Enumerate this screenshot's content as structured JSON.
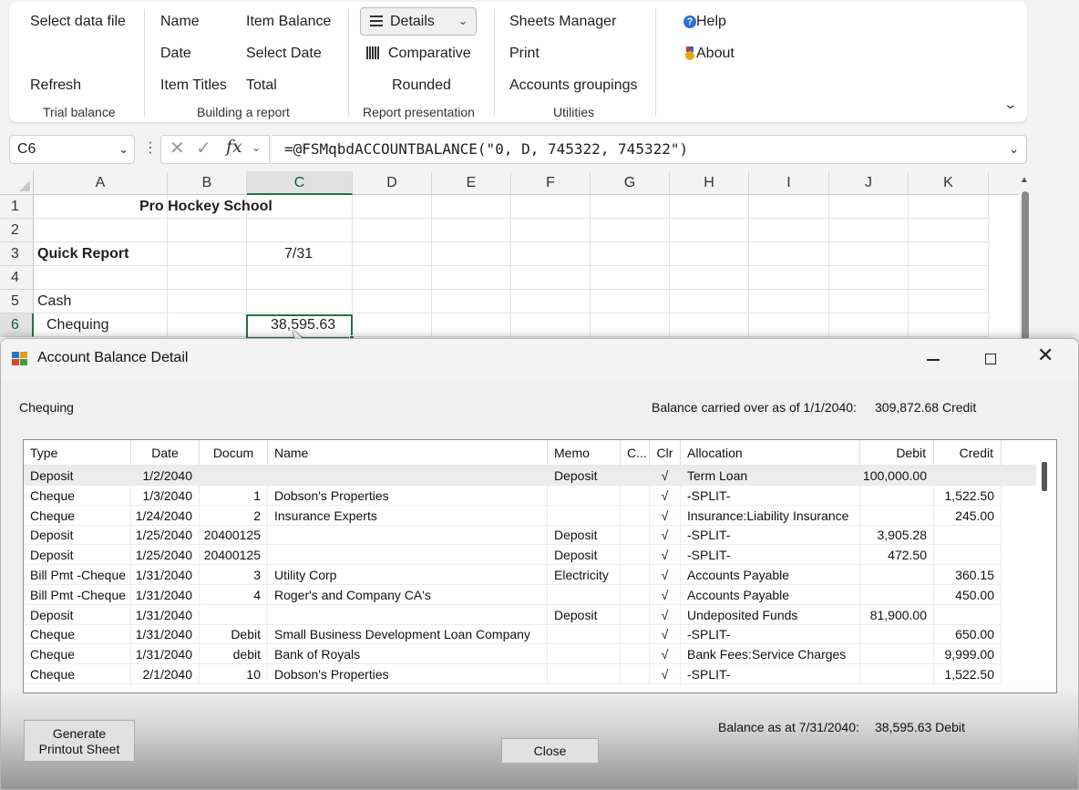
{
  "ribbon": {
    "groups": [
      {
        "label": "Trial balance",
        "buttons": [
          "Select data file",
          "Refresh"
        ]
      },
      {
        "label": "Building a report",
        "buttons": [
          "Name",
          "Item Balance",
          "Date",
          "Select Date",
          "Item Titles",
          "Total"
        ]
      },
      {
        "label": "Report presentation",
        "buttons": [
          "Details",
          "Comparative",
          "Rounded"
        ]
      },
      {
        "label": "Utilities",
        "buttons": [
          "Sheets Manager",
          "Print",
          "Accounts groupings"
        ]
      },
      {
        "label": "",
        "buttons": [
          "Help",
          "About"
        ]
      }
    ]
  },
  "formula_bar": {
    "name_box": "C6",
    "formula": "=@FSMqbdACCOUNTBALANCE(\"0, D, 745322, 745322\")"
  },
  "sheet": {
    "columns": [
      "A",
      "B",
      "C",
      "D",
      "E",
      "F",
      "G",
      "H",
      "I",
      "J",
      "K"
    ],
    "rows": [
      "1",
      "2",
      "3",
      "4",
      "5",
      "6"
    ],
    "cells": {
      "r1_title": "Pro Hockey School",
      "r3_a": "Quick Report",
      "r3_c": "7/31",
      "r5_a": "Cash",
      "r6_a": "Chequing",
      "r6_c": "38,595.63"
    }
  },
  "dialog": {
    "title": "Account Balance Detail",
    "account": "Chequing",
    "carried_label": "Balance carried over as of 1/1/2040:",
    "carried_value": "309,872.68 Credit",
    "columns": [
      "Type",
      "Date",
      "Docum",
      "Name",
      "Memo",
      "C...",
      "Clr",
      "Allocation",
      "Debit",
      "Credit"
    ],
    "rows": [
      {
        "type": "Deposit",
        "date": "1/2/2040",
        "doc": "",
        "name": "",
        "memo": "Deposit",
        "c": "",
        "clr": "√",
        "alloc": "Term Loan",
        "debit": "100,000.00",
        "credit": ""
      },
      {
        "type": "Cheque",
        "date": "1/3/2040",
        "doc": "1",
        "name": "Dobson's Properties",
        "memo": "",
        "c": "",
        "clr": "√",
        "alloc": "-SPLIT-",
        "debit": "",
        "credit": "1,522.50"
      },
      {
        "type": "Cheque",
        "date": "1/24/2040",
        "doc": "2",
        "name": "Insurance Experts",
        "memo": "",
        "c": "",
        "clr": "√",
        "alloc": "Insurance:Liability Insurance",
        "debit": "",
        "credit": "245.00"
      },
      {
        "type": "Deposit",
        "date": "1/25/2040",
        "doc": "20400125",
        "name": "",
        "memo": "Deposit",
        "c": "",
        "clr": "√",
        "alloc": "-SPLIT-",
        "debit": "3,905.28",
        "credit": ""
      },
      {
        "type": "Deposit",
        "date": "1/25/2040",
        "doc": "20400125",
        "name": "",
        "memo": "Deposit",
        "c": "",
        "clr": "√",
        "alloc": "-SPLIT-",
        "debit": "472.50",
        "credit": ""
      },
      {
        "type": "Bill Pmt -Cheque",
        "date": "1/31/2040",
        "doc": "3",
        "name": "Utility Corp",
        "memo": "Electricity",
        "c": "",
        "clr": "√",
        "alloc": "Accounts Payable",
        "debit": "",
        "credit": "360.15"
      },
      {
        "type": "Bill Pmt -Cheque",
        "date": "1/31/2040",
        "doc": "4",
        "name": "Roger's and Company CA's",
        "memo": "",
        "c": "",
        "clr": "√",
        "alloc": "Accounts Payable",
        "debit": "",
        "credit": "450.00"
      },
      {
        "type": "Deposit",
        "date": "1/31/2040",
        "doc": "",
        "name": "",
        "memo": "Deposit",
        "c": "",
        "clr": "√",
        "alloc": "Undeposited Funds",
        "debit": "81,900.00",
        "credit": ""
      },
      {
        "type": "Cheque",
        "date": "1/31/2040",
        "doc": "Debit",
        "name": "Small Business Development Loan Company",
        "memo": "",
        "c": "",
        "clr": "√",
        "alloc": "-SPLIT-",
        "debit": "",
        "credit": "650.00"
      },
      {
        "type": "Cheque",
        "date": "1/31/2040",
        "doc": "debit",
        "name": "Bank of Royals",
        "memo": "",
        "c": "",
        "clr": "√",
        "alloc": "Bank Fees:Service Charges",
        "debit": "",
        "credit": "9,999.00"
      },
      {
        "type": "Cheque",
        "date": "2/1/2040",
        "doc": "10",
        "name": "Dobson's Properties",
        "memo": "",
        "c": "",
        "clr": "√",
        "alloc": "-SPLIT-",
        "debit": "",
        "credit": "1,522.50"
      }
    ],
    "balance_label": "Balance as at 7/31/2040:",
    "balance_value": "38,595.63 Debit",
    "generate_label_1": "Generate",
    "generate_label_2": "Printout Sheet",
    "close_label": "Close"
  }
}
